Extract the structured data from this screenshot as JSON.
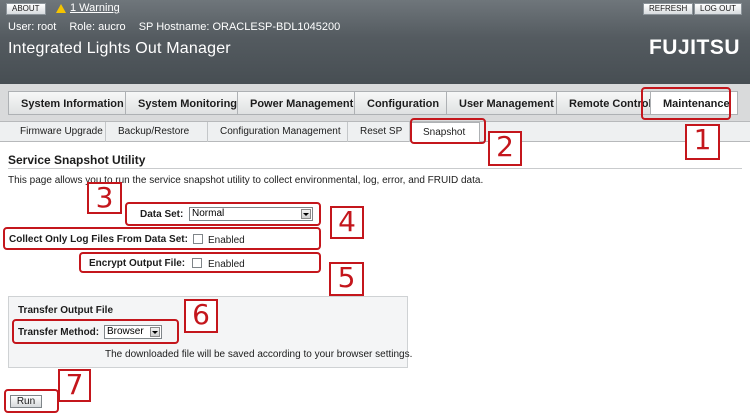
{
  "header": {
    "about_label": "ABOUT",
    "warning_label": "1 Warning",
    "refresh_label": "REFRESH",
    "logout_label": "LOG OUT",
    "user": "User: root",
    "role": "Role: aucro",
    "hostname": "SP Hostname: ORACLESP-BDL1045200",
    "title": "Integrated Lights Out Manager",
    "logo": "FUJITSU"
  },
  "main_tabs": [
    {
      "label": "System Information"
    },
    {
      "label": "System Monitoring"
    },
    {
      "label": "Power Management"
    },
    {
      "label": "Configuration"
    },
    {
      "label": "User Management"
    },
    {
      "label": "Remote Control"
    },
    {
      "label": "Maintenance"
    }
  ],
  "sub_tabs": [
    {
      "label": "Firmware Upgrade"
    },
    {
      "label": "Backup/Restore"
    },
    {
      "label": "Configuration Management"
    },
    {
      "label": "Reset SP"
    },
    {
      "label": "Snapshot"
    }
  ],
  "page": {
    "title": "Service Snapshot Utility",
    "description": "This page allows you to run the service snapshot utility to collect environmental, log, error, and FRUID data."
  },
  "form": {
    "data_set_label": "Data Set:",
    "data_set_value": "Normal",
    "log_only_label": "Collect Only Log Files From Data Set:",
    "log_only_option": "Enabled",
    "encrypt_label": "Encrypt Output File:",
    "encrypt_option": "Enabled",
    "transfer_title": "Transfer Output File",
    "transfer_method_label": "Transfer Method:",
    "transfer_method_value": "Browser",
    "transfer_note": "The downloaded file will be saved according to your browser settings.",
    "run_label": "Run"
  },
  "callouts": [
    "1",
    "2",
    "3",
    "4",
    "5",
    "6",
    "7"
  ],
  "colors": {
    "callout": "#c4161c",
    "warning": "#f5c400"
  }
}
